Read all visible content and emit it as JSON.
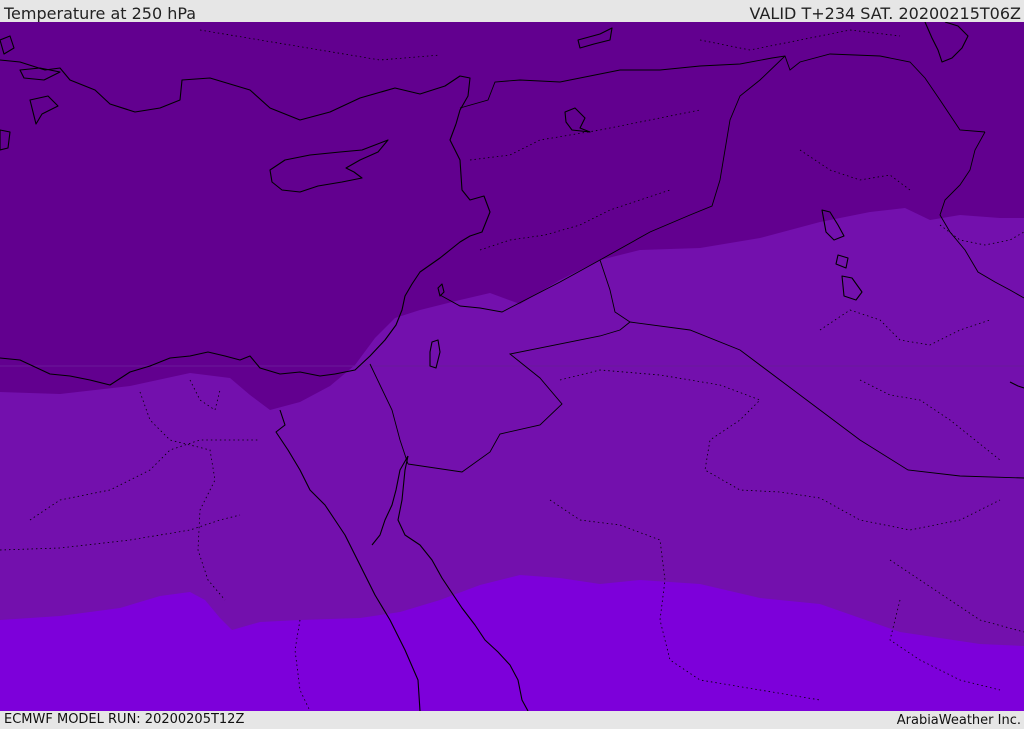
{
  "header": {
    "title": "Temperature at 250 hPa",
    "valid": "VALID T+234 SAT. 20200215T06Z"
  },
  "footer": {
    "model_run": "ECMWF MODEL RUN: 20200205T12Z",
    "credit": "ArabiaWeather Inc."
  },
  "colors": {
    "band_dark": "#62008f",
    "band_mid": "#7310ad",
    "band_light": "#7d00da",
    "boundary": "#000000",
    "bar_background": "#e6e6e6"
  }
}
